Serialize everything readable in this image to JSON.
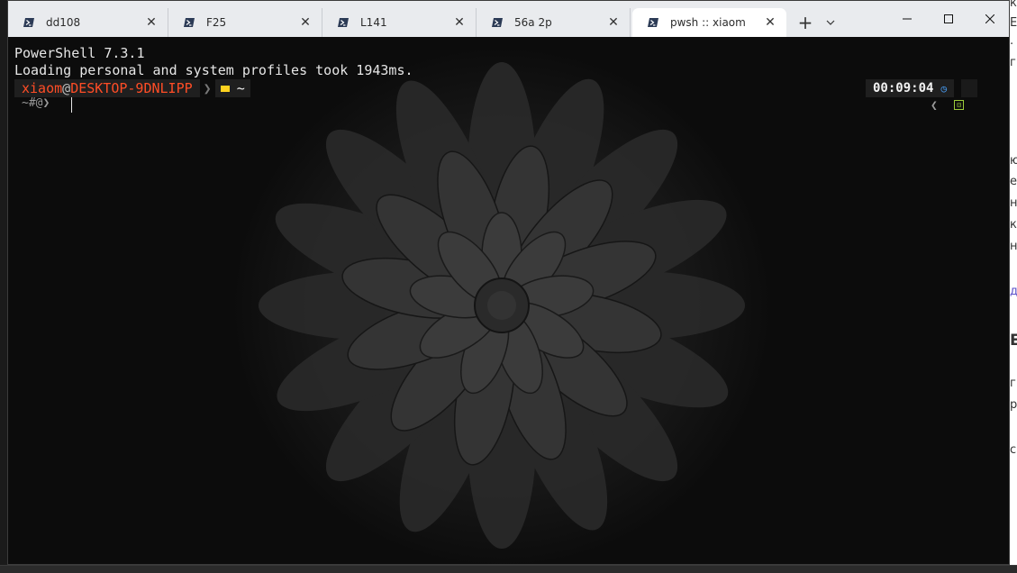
{
  "background_page": {
    "fragments": [
      "к",
      "ЕА",
      ".",
      "гр",
      "ю",
      "е",
      "нт",
      "кс",
      "н",
      "д",
      "E",
      "г",
      "р",
      "с"
    ]
  },
  "tabs": [
    {
      "label": "dd108",
      "icon": "powershell-icon",
      "active": false
    },
    {
      "label": "F25",
      "icon": "powershell-icon",
      "active": false
    },
    {
      "label": "L141",
      "icon": "powershell-icon",
      "active": false
    },
    {
      "label": "56a 2p",
      "icon": "powershell-icon",
      "active": false
    },
    {
      "label": "pwsh :: xiaom",
      "icon": "powershell-icon",
      "active": true
    }
  ],
  "tab_close_glyph": "✕",
  "new_tab_glyph": "+",
  "dropdown_glyph": "⌄",
  "window_controls": {
    "minimize": "—",
    "maximize": "☐",
    "close": "✕"
  },
  "terminal": {
    "lines": [
      "PowerShell 7.3.1",
      "Loading personal and system profiles took 1943ms."
    ],
    "prompt": {
      "user": "xiaom",
      "at": "@",
      "host": "DESKTOP-9DNLIPP",
      "separator": "❯",
      "path": "~",
      "second_line": "~#@❯"
    },
    "right_prompt": {
      "time": "00:09:04",
      "clock_glyph": "◷",
      "chevron": "❮",
      "exit_glyph": "⊟"
    }
  },
  "colors": {
    "terminal_bg": "#0c0c0c",
    "user_color": "#ff4d26",
    "folder_color": "#ffd21f",
    "clock_color": "#4aa3ff",
    "exit_color": "#9ccc3a"
  }
}
